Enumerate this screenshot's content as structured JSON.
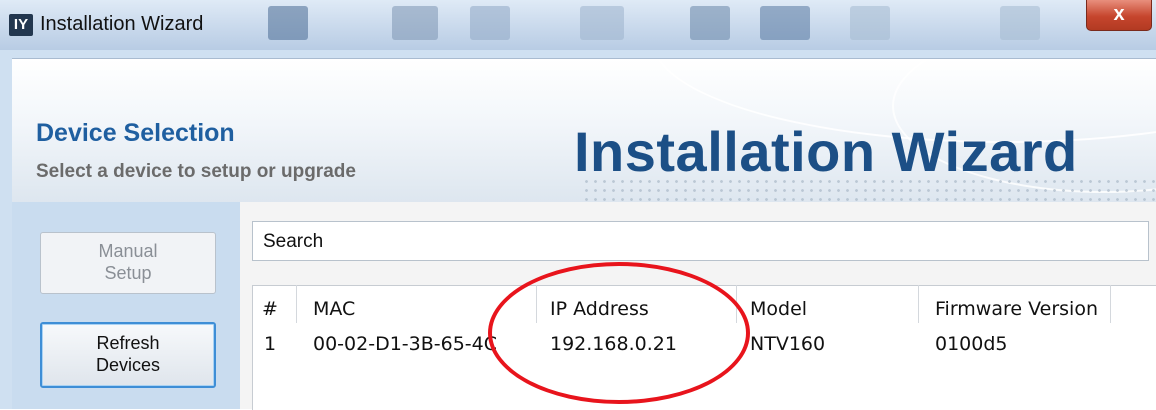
{
  "window": {
    "title": "Installation Wizard",
    "icon_text": "IY",
    "close_label": "x"
  },
  "header": {
    "section_title": "Device Selection",
    "section_subtitle": "Select a device to setup or upgrade",
    "brand_title": "Installation Wizard"
  },
  "sidebar": {
    "manual_setup": "Manual\nSetup",
    "refresh_devices": "Refresh\nDevices"
  },
  "search": {
    "label": "Search"
  },
  "table": {
    "columns": [
      "#",
      "MAC",
      "IP Address",
      "Model",
      "Firmware Version"
    ],
    "rows": [
      [
        "1",
        "00-02-D1-3B-65-4C",
        "192.168.0.21",
        "NTV160",
        "0100d5"
      ]
    ]
  },
  "annotation": {
    "highlight_color": "#e8141c",
    "highlighted_field": "IP Address"
  }
}
